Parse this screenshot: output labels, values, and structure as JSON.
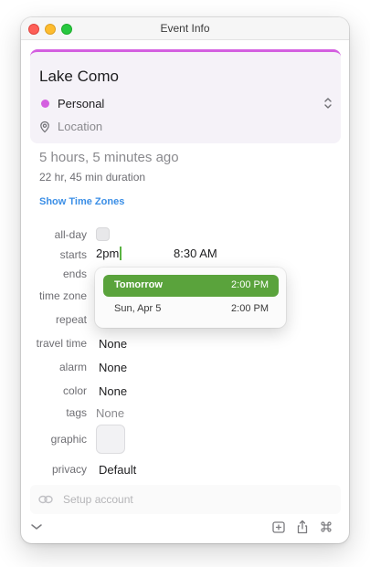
{
  "window": {
    "title": "Event Info"
  },
  "event": {
    "title": "Lake Como",
    "calendar": "Personal",
    "calendar_color": "#d45fe0",
    "location_placeholder": "Location"
  },
  "timing": {
    "relative": "5 hours, 5 minutes ago",
    "duration": "22 hr, 45 min duration",
    "show_time_zones": "Show Time Zones"
  },
  "form": {
    "labels": {
      "all_day": "all-day",
      "starts": "starts",
      "ends": "ends",
      "time_zone": "time zone",
      "repeat": "repeat",
      "travel_time": "travel time",
      "alarm": "alarm",
      "color": "color",
      "tags": "tags",
      "graphic": "graphic",
      "privacy": "privacy"
    },
    "starts_input": "2pm",
    "starts_time": "8:30 AM",
    "travel_time": "None",
    "alarm": "None",
    "color": "None",
    "tags": "None",
    "privacy": "Default"
  },
  "suggestions": [
    {
      "day": "Tomorrow",
      "time": "2:00 PM",
      "selected": true
    },
    {
      "day": "Sun, Apr 5",
      "time": "2:00 PM",
      "selected": false
    }
  ],
  "setup": {
    "label": "Setup account"
  },
  "icons": {
    "calendar_switcher": "chevron-updown-icon",
    "location": "location-pin-icon",
    "setup": "link-icon",
    "collapse": "chevron-down-icon",
    "add": "add-square-icon",
    "share": "share-icon",
    "command": "command-icon"
  },
  "colors": {
    "accent_green": "#5aa33c",
    "link_blue": "#3a8ee6",
    "card_background": "#f5f2f8"
  }
}
